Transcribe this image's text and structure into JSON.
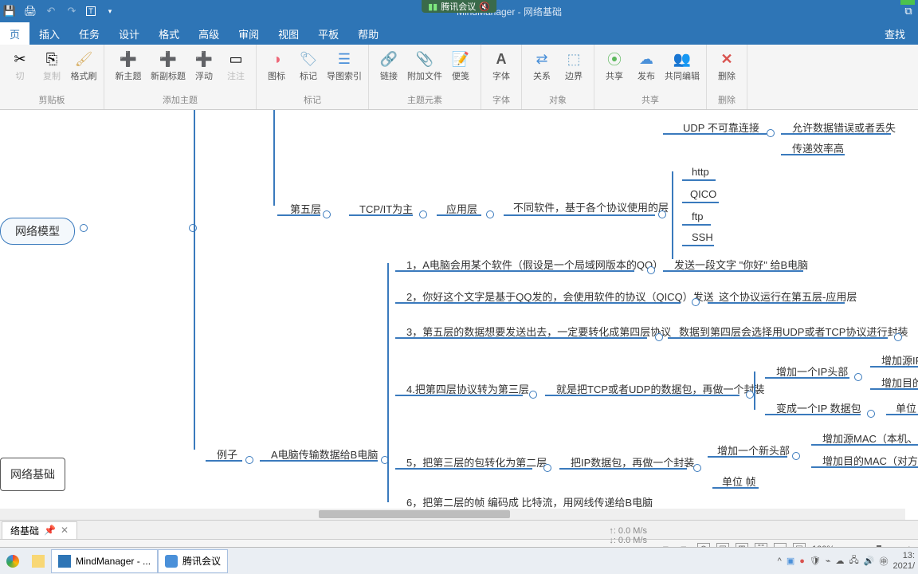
{
  "app": {
    "title": "MindManager - 网络基础",
    "meeting": "腾讯会议"
  },
  "tabs": {
    "items": [
      "页",
      "插入",
      "任务",
      "设计",
      "格式",
      "高级",
      "审阅",
      "视图",
      "平板",
      "帮助"
    ],
    "active": 0,
    "find": "查找"
  },
  "ribbon": {
    "groups": [
      {
        "label": "剪贴板",
        "buttons": [
          {
            "l": "切",
            "c": "#88a"
          },
          {
            "l": "复制",
            "c": "#aac"
          },
          {
            "l": "格式刷",
            "c": "#d9b36c"
          }
        ]
      },
      {
        "label": "添加主题",
        "buttons": [
          {
            "l": "新主题",
            "c": "#6abf60"
          },
          {
            "l": "新副标题",
            "c": "#6abf60"
          },
          {
            "l": "浮动",
            "c": "#6abf60"
          },
          {
            "l": "注注",
            "c": "#ccc"
          }
        ]
      },
      {
        "label": "标记",
        "buttons": [
          {
            "l": "图标",
            "c": "#e67"
          },
          {
            "l": "标记",
            "c": "#7ac"
          },
          {
            "l": "导图索引",
            "c": "#4a90d9"
          }
        ]
      },
      {
        "label": "主题元素",
        "buttons": [
          {
            "l": "链接",
            "c": "#8aa"
          },
          {
            "l": "附加文件",
            "c": "#999"
          },
          {
            "l": "便笺",
            "c": "#c9a96e"
          }
        ]
      },
      {
        "label": "字体",
        "buttons": [
          {
            "l": "字体",
            "c": "#555"
          }
        ]
      },
      {
        "label": "对象",
        "buttons": [
          {
            "l": "关系",
            "c": "#4a90d9"
          },
          {
            "l": "边界",
            "c": "#7ac"
          }
        ]
      },
      {
        "label": "共享",
        "buttons": [
          {
            "l": "共享",
            "c": "#5cb85c"
          },
          {
            "l": "发布",
            "c": "#4a90d9"
          },
          {
            "l": "共同编辑",
            "c": "#888"
          }
        ]
      },
      {
        "label": "删除",
        "buttons": [
          {
            "l": "删除",
            "c": "#d9534f"
          }
        ]
      }
    ]
  },
  "mindmap": {
    "root": "网络基础",
    "center": "网络模型",
    "l5": "第五层",
    "tcp": "TCP/IT为主",
    "app": "应用层",
    "appdesc": "不同软件，基于各个协议使用的层",
    "proto": [
      "http",
      "QICO",
      "ftp",
      "SSH"
    ],
    "udp": "UDP 不可靠连接",
    "udp1": "允许数据错误或者丢失",
    "udp2": "传递效率高",
    "example": "例子",
    "extitle": "A电脑传输数据给B电脑",
    "s1": "1，A电脑会用某个软件（假设是一个局域网版本的QQ）",
    "s1r": "发送一段文字 \"你好\" 给B电脑",
    "s2": "2，你好这个文字是基于QQ发的，会使用软件的协议（QICQ）发送",
    "s2r": "这个协议运行在第五层-应用层",
    "s3": "3，第五层的数据想要发送出去，一定要转化成第四层协议",
    "s3r": "数据到第四层会选择用UDP或者TCP协议进行封装",
    "s4": "4.把第四层协议转为第三层",
    "s4r": "就是把TCP或者UDP的数据包，再做一个封装",
    "s4a": "增加一个IP头部",
    "s4a1": "增加源IP",
    "s4a2": "增加目的I",
    "s4b": "变成一个IP 数据包",
    "s4b1": "单位",
    "s5": "5，把第三层的包转化为第二层",
    "s5r": "把IP数据包，再做一个封装",
    "s5a": "增加一个新头部",
    "s5a1": "增加源MAC（本机、AE",
    "s5a2": "增加目的MAC（对方、",
    "s5b": "单位 帧",
    "s6": "6，把第二层的帧 编码成 比特流，用网线传递给B电脑"
  },
  "doc": {
    "tab": "络基础",
    "pin": "📌"
  },
  "status": {
    "zoom": "100%",
    "netup": "↑: 0.0 M/s",
    "netdown": "↓: 0.0 M/s"
  },
  "taskbar": {
    "items": [
      {
        "l": "MindManager - ...",
        "ic": "#2e75b6"
      },
      {
        "l": "腾讯会议",
        "ic": "#4a90d9"
      }
    ],
    "time": "13:",
    "date": "2021/"
  }
}
